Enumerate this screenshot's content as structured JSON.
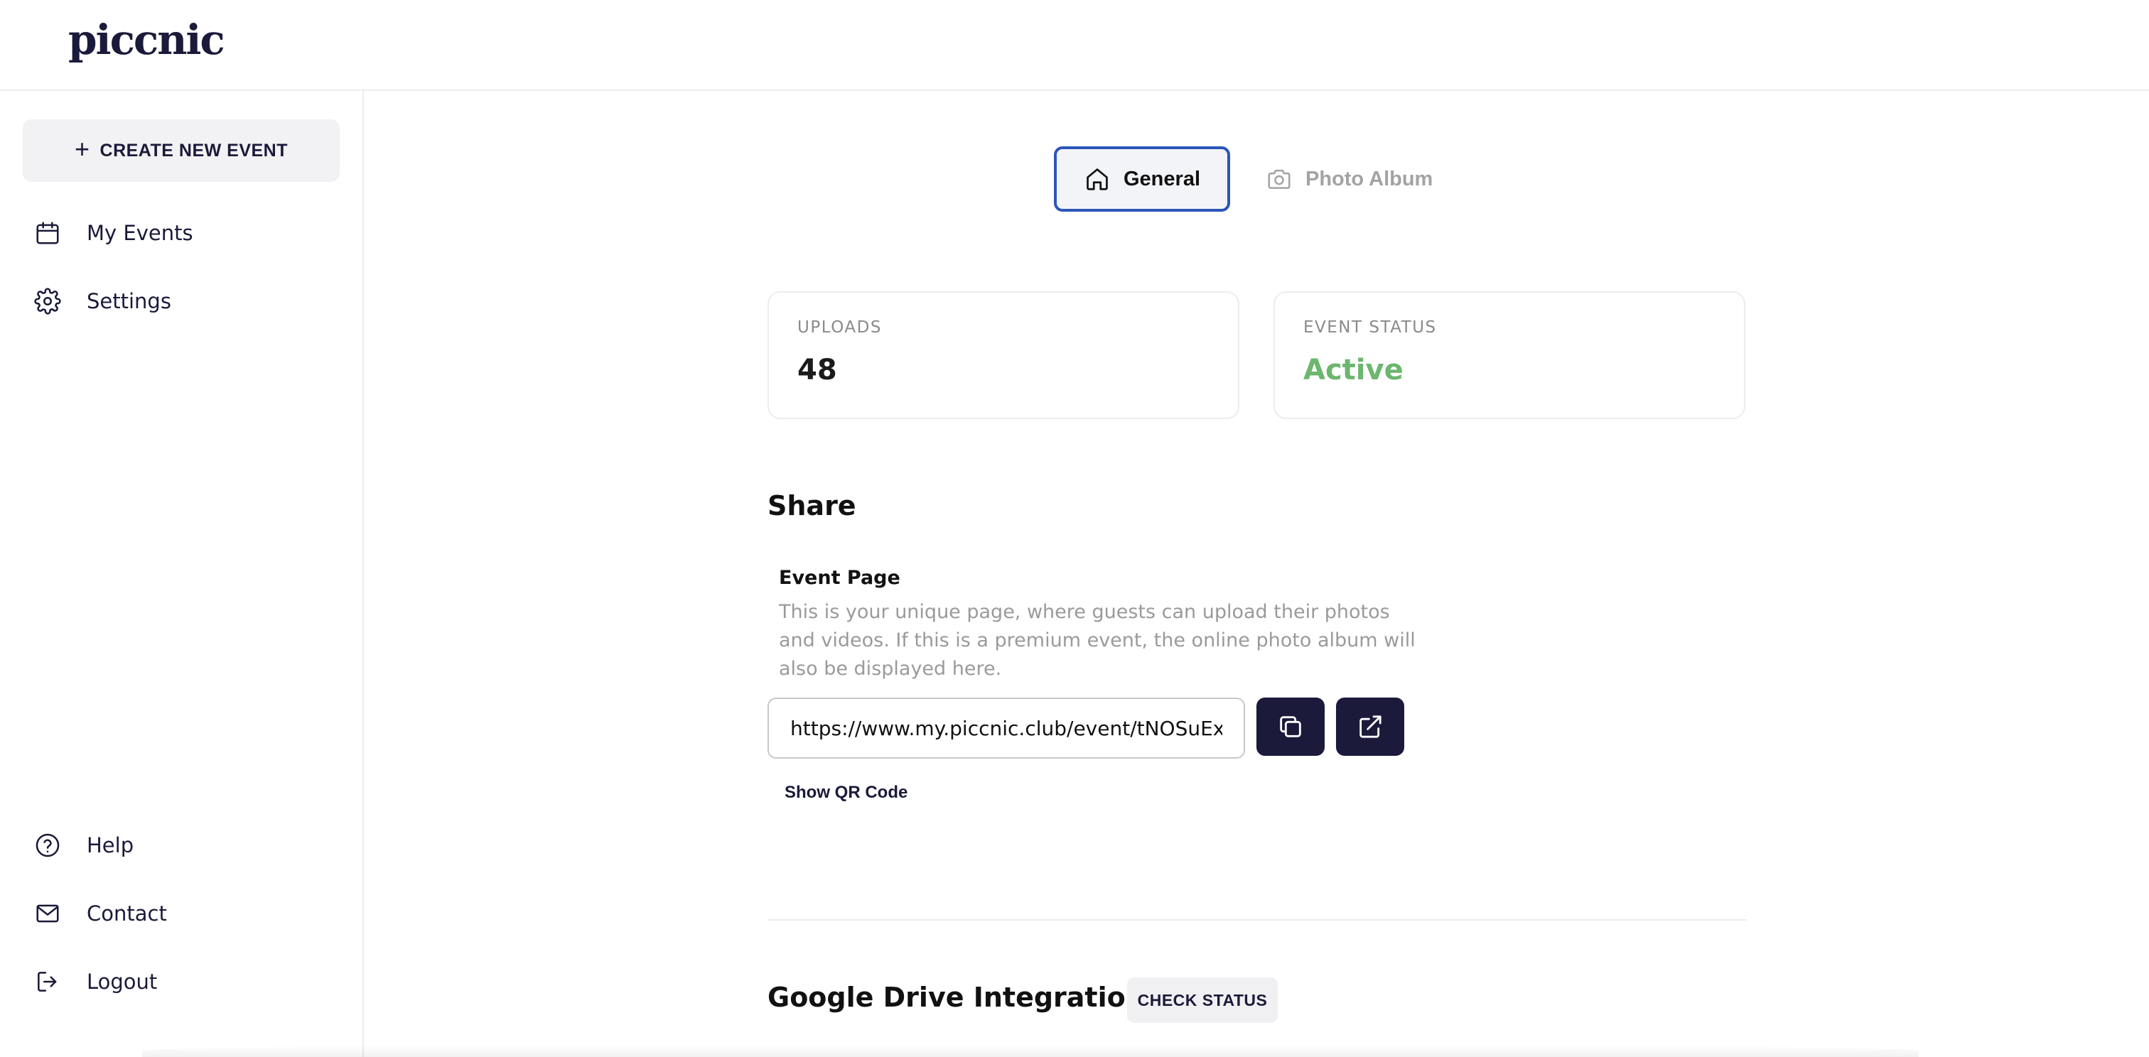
{
  "header": {
    "logo_text": "piccnic"
  },
  "sidebar": {
    "create_label": "CREATE NEW EVENT",
    "top_items": [
      {
        "label": "My Events",
        "icon": "calendar-icon"
      },
      {
        "label": "Settings",
        "icon": "gear-icon"
      }
    ],
    "bottom_items": [
      {
        "label": "Help",
        "icon": "help-circle-icon"
      },
      {
        "label": "Contact",
        "icon": "mail-icon"
      },
      {
        "label": "Logout",
        "icon": "logout-icon"
      }
    ]
  },
  "tabs": [
    {
      "label": "General",
      "icon": "home-icon",
      "active": true
    },
    {
      "label": "Photo Album",
      "icon": "camera-icon",
      "active": false
    }
  ],
  "stats": {
    "uploads": {
      "label": "UPLOADS",
      "value": "48"
    },
    "status": {
      "label": "EVENT STATUS",
      "value": "Active",
      "color": "#6cb66e"
    }
  },
  "share": {
    "title": "Share",
    "event_page_title": "Event Page",
    "event_page_desc": "This is your unique page, where guests can upload their photos and videos. If this is a premium event, the online photo album will also be displayed here.",
    "url": "https://www.my.piccnic.club/event/tNOSuEx",
    "copy_icon": "copy-icon",
    "open_icon": "external-link-icon",
    "qr_label": "Show QR Code"
  },
  "drive": {
    "title": "Google Drive Integration",
    "check_label": "CHECK STATUS"
  },
  "colors": {
    "brand_dark": "#1b1a3a",
    "active_tab_border": "#2b55b8",
    "status_green": "#6cb66e"
  }
}
